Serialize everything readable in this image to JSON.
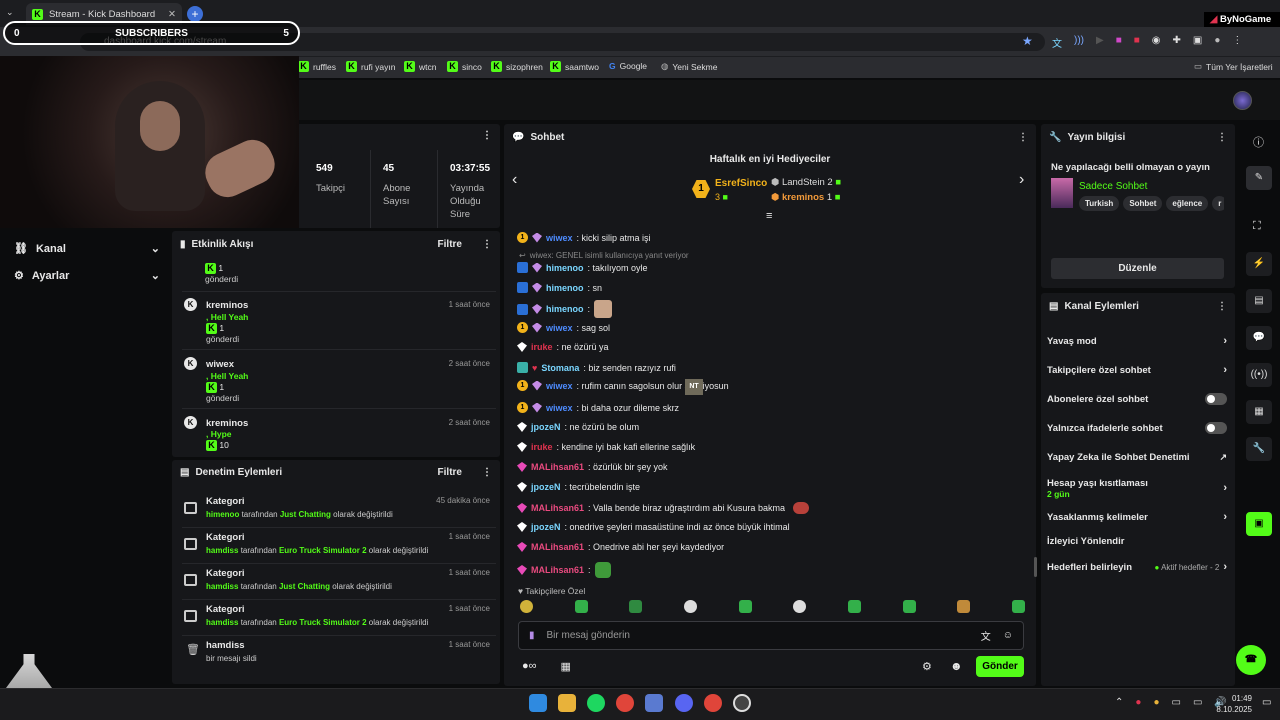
{
  "browser": {
    "tab_title": "Stream - Kick Dashboard",
    "url": "dashboard.kick.com/stream",
    "brand": "ByNoGame",
    "bookmarks": [
      "ruffles",
      "rufi yayın",
      "wtcn",
      "sinco",
      "sizophren",
      "saamtwo",
      "Google",
      "Yeni Sekme"
    ],
    "all_bookmarks": "Tüm Yer İşaretleri"
  },
  "overlay": {
    "subs_label": "SUBSCRIBERS",
    "subs_left": "0",
    "subs_right": "5"
  },
  "stats": {
    "followers_value": "549",
    "followers_label": "Takipçi",
    "subs_value": "45",
    "subs_label1": "Abone",
    "subs_label2": "Sayısı",
    "uptime_value": "03:37:55",
    "uptime_l1": "Yayında",
    "uptime_l2": "Olduğu",
    "uptime_l3": "Süre"
  },
  "nav": {
    "kanal": "Kanal",
    "ayarlar": "Ayarlar"
  },
  "activity": {
    "title": "Etkinlik Akışı",
    "filter": "Filtre",
    "top_count": "1",
    "top_sent": "gönderdi",
    "events": [
      {
        "name": "kreminos",
        "kind": ", Hell Yeah",
        "count": "1",
        "sent": "gönderdi",
        "time": "1 saat önce"
      },
      {
        "name": "wiwex",
        "kind": ", Hell Yeah",
        "count": "1",
        "sent": "gönderdi",
        "time": "2 saat önce"
      },
      {
        "name": "kreminos",
        "kind": ", Hype",
        "count": "10",
        "sent": "",
        "time": "2 saat önce"
      }
    ]
  },
  "moderation": {
    "title": "Denetim Eylemleri",
    "filter": "Filtre",
    "items": [
      {
        "title": "Kategori",
        "user": "himenoo",
        "mid": " tarafından ",
        "target": "Just Chatting",
        "end": " olarak değiştirildi",
        "time": "45 dakika önce"
      },
      {
        "title": "Kategori",
        "user": "hamdiss",
        "mid": " tarafından ",
        "target": "Euro Truck Simulator 2",
        "end": " olarak değiştirildi",
        "time": "1 saat önce"
      },
      {
        "title": "Kategori",
        "user": "hamdiss",
        "mid": " tarafından ",
        "target": "Just Chatting",
        "end": " olarak değiştirildi",
        "time": "1 saat önce"
      },
      {
        "title": "Kategori",
        "user": "hamdiss",
        "mid": " tarafından ",
        "target": "Euro Truck Simulator 2",
        "end": " olarak değiştirildi",
        "time": "1 saat önce"
      },
      {
        "title": "hamdiss",
        "user": "",
        "mid": "bir mesajı sildi",
        "target": "",
        "end": "",
        "time": "1 saat önce"
      }
    ]
  },
  "chat": {
    "title": "Sohbet",
    "gifters_title": "Haftalık en iyi Hediyeciler",
    "first_name": "EsrefSinco",
    "first_rank": "1",
    "first_count": "3",
    "second_name": "LandStein",
    "second_count": "2",
    "third_name": "kreminos",
    "third_count": "1",
    "reply_note": "wiwex: GENEL isimli kullanıcıya yanıt veriyor",
    "messages": [
      {
        "user": "wiwex",
        "cls": "u-blue",
        "text": ": kicki silip atma işi",
        "b": "sub"
      },
      {
        "user": "himenoo",
        "cls": "u-cyan",
        "text": ": takılıyom oyle",
        "b": "blue"
      },
      {
        "user": "himenoo",
        "cls": "u-cyan",
        "text": ": sn",
        "b": "blue"
      },
      {
        "user": "himenoo",
        "cls": "u-cyan",
        "text": ":",
        "b": "blue"
      },
      {
        "user": "wiwex",
        "cls": "u-blue",
        "text": ": sag sol",
        "b": "sub"
      },
      {
        "user": "iruke",
        "cls": "u-red",
        "text": ": ne özürü ya",
        "b": "white"
      },
      {
        "user": "Stomana",
        "cls": "u-cyan",
        "text": ": biz senden razıyız rufi",
        "b": "blue"
      },
      {
        "user": "wiwex",
        "cls": "u-blue",
        "text": ": rufim canın sagolsun olur  seviliyosun",
        "b": "sub"
      },
      {
        "user": "wiwex",
        "cls": "u-blue",
        "text": ": bi daha ozur dileme skrz",
        "b": "sub"
      },
      {
        "user": "jpozeN",
        "cls": "u-cyan",
        "text": ": ne özürü be olum",
        "b": "white"
      },
      {
        "user": "iruke",
        "cls": "u-red",
        "text": ": kendine iyi bak kafi ellerine sağlık",
        "b": "white"
      },
      {
        "user": "MALihsan61",
        "cls": "u-pink",
        "text": ": özürlük bir şey yok",
        "b": "pink"
      },
      {
        "user": "jpozeN",
        "cls": "u-cyan",
        "text": ": tecrübelendin işte",
        "b": "white"
      },
      {
        "user": "MALihsan61",
        "cls": "u-pink",
        "text": ": Valla bende biraz uğraştırdım abi Kusura bakma",
        "b": "pink"
      },
      {
        "user": "jpozeN",
        "cls": "u-cyan",
        "text": ": onedrive şeyleri masaüstüne indi az önce büyük ihtimal",
        "b": "white"
      },
      {
        "user": "MALihsan61",
        "cls": "u-pink",
        "text": ": Onedrive abi her şeyi kaydediyor",
        "b": "pink"
      },
      {
        "user": "MALihsan61",
        "cls": "u-pink",
        "text": ":",
        "b": "pink"
      }
    ],
    "followers_only": "Takipçilere Özel",
    "input_placeholder": "Bir mesaj gönderin",
    "send": "Gönder"
  },
  "stream_info": {
    "title": "Yayın bilgisi",
    "stream_title": "Ne yapılacağı belli olmayan o yayın",
    "category": "Sadece Sohbet",
    "tags": [
      "Turkish",
      "Sohbet",
      "eğlence",
      "r"
    ],
    "edit": "Düzenle"
  },
  "channel_actions": {
    "title": "Kanal Eylemleri",
    "slow": "Yavaş mod",
    "followers": "Takipçilere özel sohbet",
    "subs": "Abonelere özel sohbet",
    "emotes": "Yalnızca ifadelerle sohbet",
    "ai": "Yapay Zeka ile Sohbet Denetimi",
    "age": "Hesap yaşı kısıtlaması",
    "age_val": "2 gün",
    "banned": "Yasaklanmış kelimeler",
    "redirect": "İzleyici Yönlendir",
    "goals": "Hedefleri belirleyin",
    "goals_val": "Aktif hedefler - 2"
  },
  "taskbar": {
    "time": "01:49",
    "date": "8.10.2025"
  },
  "colors": {
    "kick_green": "#53fc18",
    "panel": "#16171a"
  }
}
